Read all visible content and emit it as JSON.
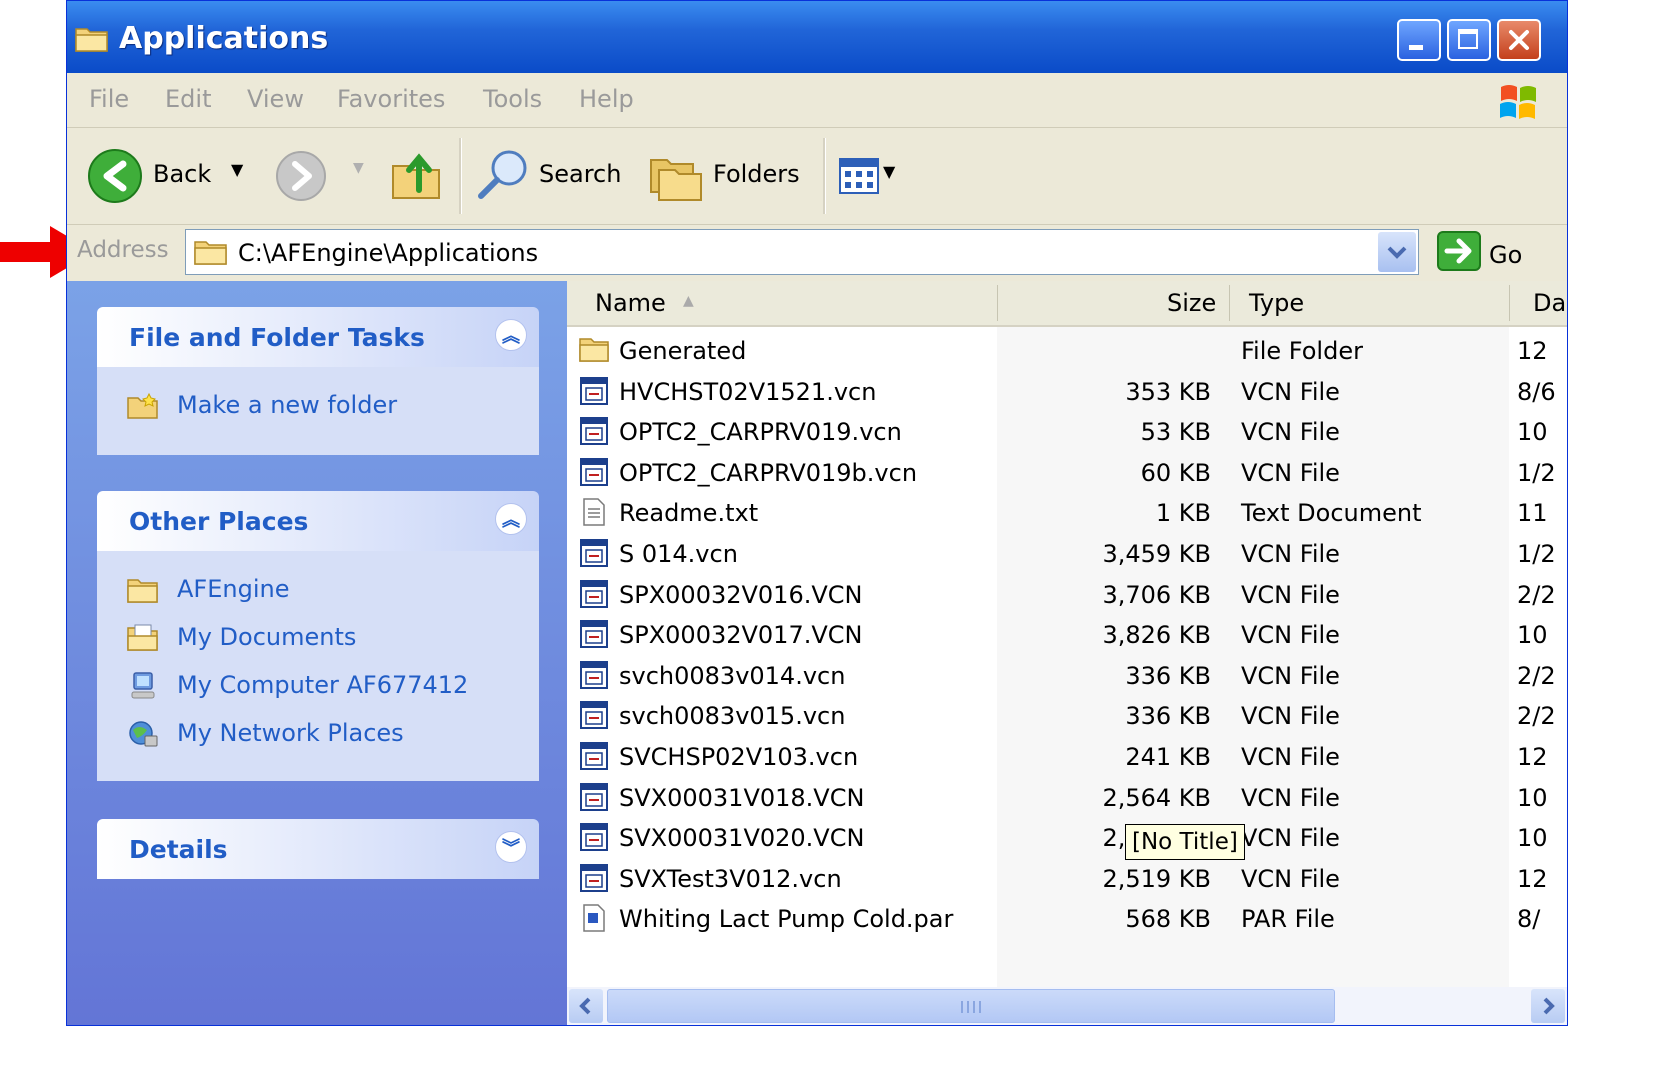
{
  "window": {
    "title": "Applications"
  },
  "menu": [
    "File",
    "Edit",
    "View",
    "Favorites",
    "Tools",
    "Help"
  ],
  "toolbar": {
    "back": "Back",
    "search": "Search",
    "folders": "Folders"
  },
  "address": {
    "label": "Address",
    "path": "C:\\AFEngine\\Applications",
    "go": "Go"
  },
  "task_panes": {
    "file_tasks": {
      "title": "File and Folder Tasks",
      "items": [
        "Make a new folder"
      ]
    },
    "other_places": {
      "title": "Other Places",
      "items": [
        "AFEngine",
        "My Documents",
        "My Computer AF677412",
        "My Network Places"
      ]
    },
    "details": {
      "title": "Details"
    }
  },
  "columns": {
    "name": "Name",
    "size": "Size",
    "type": "Type",
    "date": "Da"
  },
  "files": [
    {
      "name": "Generated",
      "size": "",
      "type": "File Folder",
      "date": "12",
      "icon": "folder-icon"
    },
    {
      "name": "HVCHST02V1521.vcn",
      "size": "353 KB",
      "type": "VCN File",
      "date": "8/6",
      "icon": "vcn-file-icon"
    },
    {
      "name": "OPTC2_CARPRV019.vcn",
      "size": "53 KB",
      "type": "VCN File",
      "date": "10",
      "icon": "vcn-file-icon"
    },
    {
      "name": "OPTC2_CARPRV019b.vcn",
      "size": "60 KB",
      "type": "VCN File",
      "date": "1/2",
      "icon": "vcn-file-icon"
    },
    {
      "name": "Readme.txt",
      "size": "1 KB",
      "type": "Text Document",
      "date": "11",
      "icon": "text-file-icon"
    },
    {
      "name": "S         014.vcn",
      "size": "3,459 KB",
      "type": "VCN File",
      "date": "1/2",
      "icon": "vcn-file-icon"
    },
    {
      "name": "SPX00032V016.VCN",
      "size": "3,706 KB",
      "type": "VCN File",
      "date": "2/2",
      "icon": "vcn-file-icon"
    },
    {
      "name": "SPX00032V017.VCN",
      "size": "3,826 KB",
      "type": "VCN File",
      "date": "10",
      "icon": "vcn-file-icon"
    },
    {
      "name": "svch0083v014.vcn",
      "size": "336 KB",
      "type": "VCN File",
      "date": "2/2",
      "icon": "vcn-file-icon"
    },
    {
      "name": "svch0083v015.vcn",
      "size": "336 KB",
      "type": "VCN File",
      "date": "2/2",
      "icon": "vcn-file-icon"
    },
    {
      "name": "SVCHSP02V103.vcn",
      "size": "241 KB",
      "type": "VCN File",
      "date": "12",
      "icon": "vcn-file-icon"
    },
    {
      "name": "SVX00031V018.VCN",
      "size": "2,564 KB",
      "type": "VCN File",
      "date": "10",
      "icon": "vcn-file-icon"
    },
    {
      "name": "SVX00031V020.VCN",
      "size": "2,710 KB",
      "type": "VCN File",
      "date": "10",
      "icon": "vcn-file-icon"
    },
    {
      "name": "SVXTest3V012.vcn",
      "size": "2,519 KB",
      "type": "VCN File",
      "date": "12",
      "icon": "vcn-file-icon"
    },
    {
      "name": "Whiting Lact Pump Cold.par",
      "size": "568 KB",
      "type": "PAR File",
      "date": "8/",
      "icon": "par-file-icon"
    }
  ],
  "tooltip": "[No Title]",
  "colors": {
    "title_bar": "#0a4bc8",
    "task_pane": "#6375d6",
    "task_link": "#215dc6",
    "annotation": "#ee0000"
  }
}
